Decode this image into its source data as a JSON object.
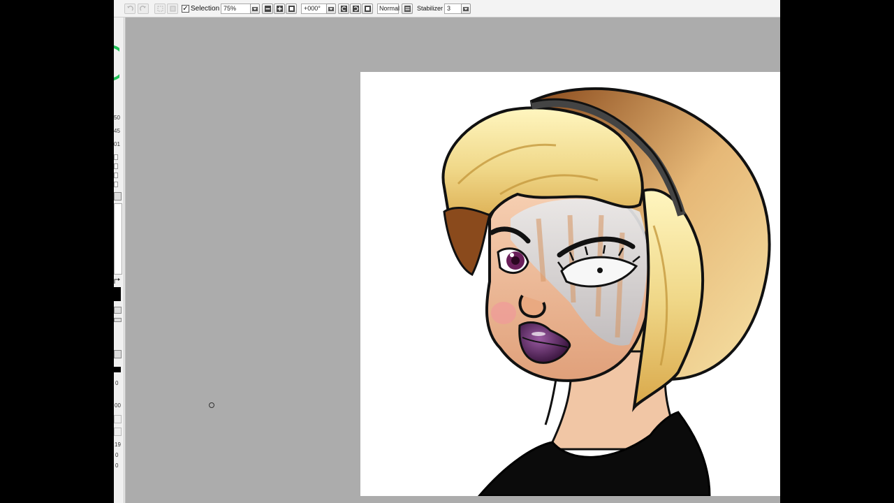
{
  "toolbar": {
    "selection_label": "Selection",
    "selection_checked": "✓",
    "zoom": "75%",
    "rotation": "+000°",
    "blend_mode": "Normal",
    "stabilizer_label": "Stabilizer",
    "stabilizer_value": "3"
  },
  "left_panel": {
    "values": [
      "50",
      "45",
      "01"
    ],
    "readouts": [
      "0",
      "00",
      "19",
      "0",
      "0"
    ]
  }
}
